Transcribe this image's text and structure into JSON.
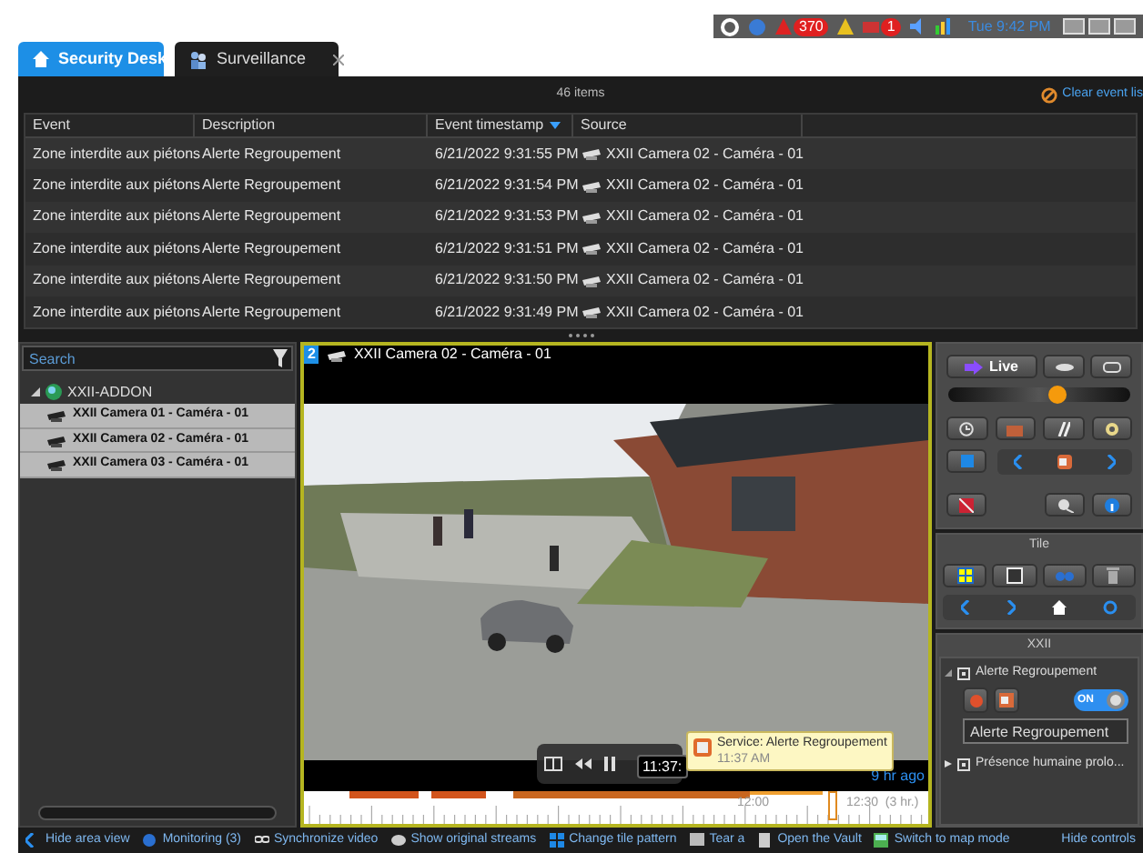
{
  "tray": {
    "badges": [
      "370",
      "1"
    ],
    "clock": "Tue 9:42 PM"
  },
  "tabs": [
    {
      "label": "Security Desk",
      "kind": "home",
      "selected": false
    },
    {
      "label": "Surveillance",
      "kind": "task",
      "selected": true
    }
  ],
  "event_list": {
    "count": "46 items",
    "clear_label": "Clear event lis",
    "columns": [
      {
        "label": "Event",
        "sorted": false
      },
      {
        "label": "Description",
        "sorted": false
      },
      {
        "label": "Event timestamp",
        "sorted": true
      },
      {
        "label": "Source",
        "sorted": false
      }
    ],
    "rows": [
      [
        "Zone interdite aux piétons",
        "Alerte Regroupement",
        "6/21/2022 9:31:55 PM",
        "XXII Camera 02 - Caméra - 01"
      ],
      [
        "Zone interdite aux piétons",
        "Alerte Regroupement",
        "6/21/2022 9:31:54 PM",
        "XXII Camera 02 - Caméra - 01"
      ],
      [
        "Zone interdite aux piétons",
        "Alerte Regroupement",
        "6/21/2022 9:31:53 PM",
        "XXII Camera 02 - Caméra - 01"
      ],
      [
        "Zone interdite aux piétons",
        "Alerte Regroupement",
        "6/21/2022 9:31:51 PM",
        "XXII Camera 02 - Caméra - 01"
      ],
      [
        "Zone interdite aux piétons",
        "Alerte Regroupement",
        "6/21/2022 9:31:50 PM",
        "XXII Camera 02 - Caméra - 01"
      ],
      [
        "Zone interdite aux piétons",
        "Alerte Regroupement",
        "6/21/2022 9:31:49 PM",
        "XXII Camera 02 - Caméra - 01"
      ]
    ]
  },
  "area_view": {
    "search_placeholder": "Search",
    "tree": [
      {
        "label": "XXII-ADDON",
        "expanded": true,
        "children": [
          {
            "label": "XXII Camera 01 - Caméra - 01",
            "selected": true
          },
          {
            "label": "XXII Camera 02 - Caméra - 01",
            "selected": true
          },
          {
            "label": "XXII Camera 03 - Caméra - 01",
            "selected": true
          }
        ]
      }
    ]
  },
  "tile": {
    "number": "2",
    "title": "XXII Camera 02 - Caméra - 01",
    "overlay_time": "11:37:",
    "tooltip": {
      "title": "Service: Alerte Regroupement",
      "time": "11:37 AM"
    },
    "ago": "9 hr ago",
    "timeline_labels": [
      "12:00",
      "12:30  (3 hr.)"
    ],
    "cursor": {
      "level": 0.84
    }
  },
  "controls": {
    "live_label": "Live",
    "speed": {
      "level": 0.6
    },
    "tile_heading": "Tile",
    "group_heading": "XXII",
    "actions": [
      {
        "label": "Alerte Regroupement",
        "expanded": true,
        "on": true,
        "on_label": "ON",
        "name_field": {
          "value": "Alerte Regroupement"
        }
      },
      {
        "label": "Présence humaine prolo...",
        "expanded": false
      }
    ]
  },
  "toolbar": [
    "Hide area view",
    "Monitoring (3)",
    "Synchronize video",
    "Show original streams",
    "Change tile pattern",
    "Tear a",
    "Open the Vault",
    "Switch to map mode",
    "Hide controls"
  ]
}
